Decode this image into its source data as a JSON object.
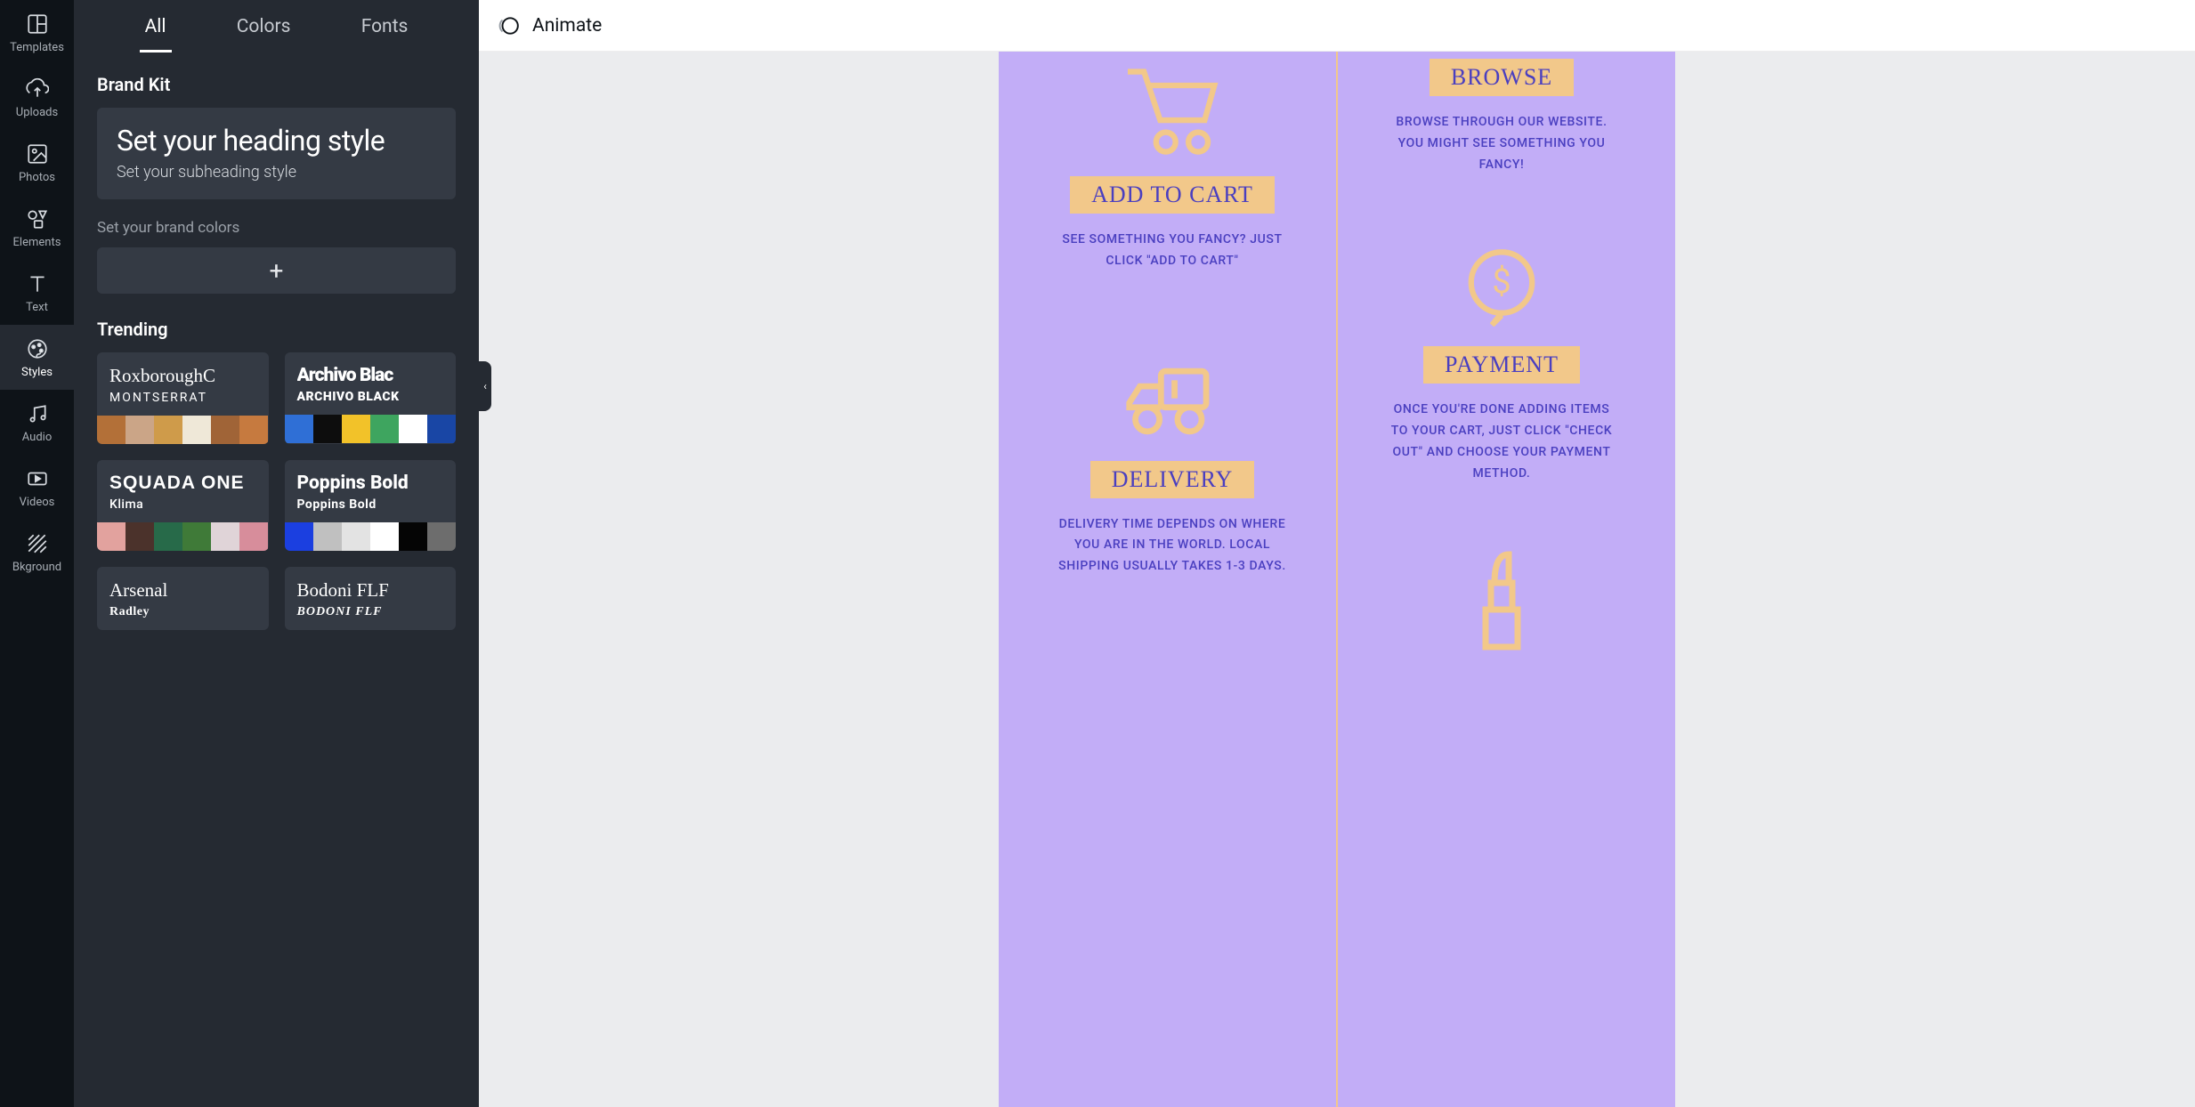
{
  "rail": [
    {
      "name": "templates",
      "label": "Templates"
    },
    {
      "name": "uploads",
      "label": "Uploads"
    },
    {
      "name": "photos",
      "label": "Photos"
    },
    {
      "name": "elements",
      "label": "Elements"
    },
    {
      "name": "text",
      "label": "Text"
    },
    {
      "name": "styles",
      "label": "Styles"
    },
    {
      "name": "audio",
      "label": "Audio"
    },
    {
      "name": "videos",
      "label": "Videos"
    },
    {
      "name": "bkground",
      "label": "Bkground"
    }
  ],
  "panel": {
    "tabs": {
      "all": "All",
      "colors": "Colors",
      "fonts": "Fonts"
    },
    "brandkit": {
      "title": "Brand Kit",
      "heading": "Set your heading style",
      "subheading": "Set your subheading style",
      "colors_label": "Set your brand colors",
      "add": "+"
    },
    "trending": {
      "title": "Trending",
      "cards": [
        {
          "primary": "RoxboroughC",
          "secondary": "MONTSERRAT",
          "primary_css": "font-family:Georgia,serif;font-weight:400;",
          "secondary_css": "letter-spacing:2px;font-weight:400;",
          "swatches": [
            "#b37038",
            "#cba587",
            "#cf9b4a",
            "#efe8d8",
            "#a06437",
            "#c67a3f"
          ]
        },
        {
          "primary": "Archivo Blac",
          "secondary": "ARCHIVO BLACK",
          "primary_css": "font-weight:900;letter-spacing:-1px;",
          "secondary_css": "font-weight:900;letter-spacing:0.5px;",
          "swatches": [
            "#2f6fd6",
            "#0d0d0d",
            "#f2c229",
            "#3ea55f",
            "#ffffff",
            "#1946a5"
          ]
        },
        {
          "primary": "SQUADA ONE",
          "secondary": "Klima",
          "primary_css": "font-family:Impact,sans-serif;letter-spacing:1px;",
          "secondary_css": "font-weight:500;",
          "swatches": [
            "#e2a29e",
            "#4b322b",
            "#276a49",
            "#3f7a38",
            "#e0d4d8",
            "#d78d9b"
          ]
        },
        {
          "primary": "Poppins Bold",
          "secondary": "Poppins Bold",
          "primary_css": "font-weight:800;",
          "secondary_css": "font-weight:700;",
          "swatches": [
            "#1b3fe0",
            "#c0c0c0",
            "#e3e3e3",
            "#ffffff",
            "#050505",
            "#6d6d6d"
          ]
        },
        {
          "primary": "Arsenal",
          "secondary": "Radley",
          "primary_css": "font-family:Georgia,serif;font-weight:400;",
          "secondary_css": "font-family:Georgia,serif;",
          "swatches": []
        },
        {
          "primary": "Bodoni FLF",
          "secondary": "BODONI FLF",
          "primary_css": "font-family:'Didot',Georgia,serif;font-weight:400;",
          "secondary_css": "font-family:'Didot',Georgia,serif;font-style:italic;letter-spacing:1px;",
          "swatches": []
        }
      ]
    }
  },
  "topbar": {
    "animate": "Animate"
  },
  "canvas": {
    "left": [
      {
        "icon": "cart",
        "badge": "ADD TO CART",
        "desc": "SEE SOMETHING YOU FANCY? JUST CLICK \"ADD TO CART\""
      },
      {
        "icon": "truck",
        "badge": "DELIVERY",
        "desc": "DELIVERY TIME DEPENDS ON WHERE YOU ARE IN THE WORLD. LOCAL SHIPPING USUALLY TAKES 1-3 DAYS."
      }
    ],
    "right": [
      {
        "icon": "",
        "badge": "BROWSE",
        "desc": "BROWSE THROUGH OUR WEBSITE. YOU MIGHT SEE SOMETHING YOU FANCY!"
      },
      {
        "icon": "dollar",
        "badge": "PAYMENT",
        "desc": "ONCE YOU'RE DONE ADDING ITEMS TO YOUR CART, JUST CLICK \"CHECK OUT\" AND CHOOSE YOUR PAYMENT METHOD."
      },
      {
        "icon": "lipstick",
        "badge": "",
        "desc": ""
      }
    ]
  }
}
